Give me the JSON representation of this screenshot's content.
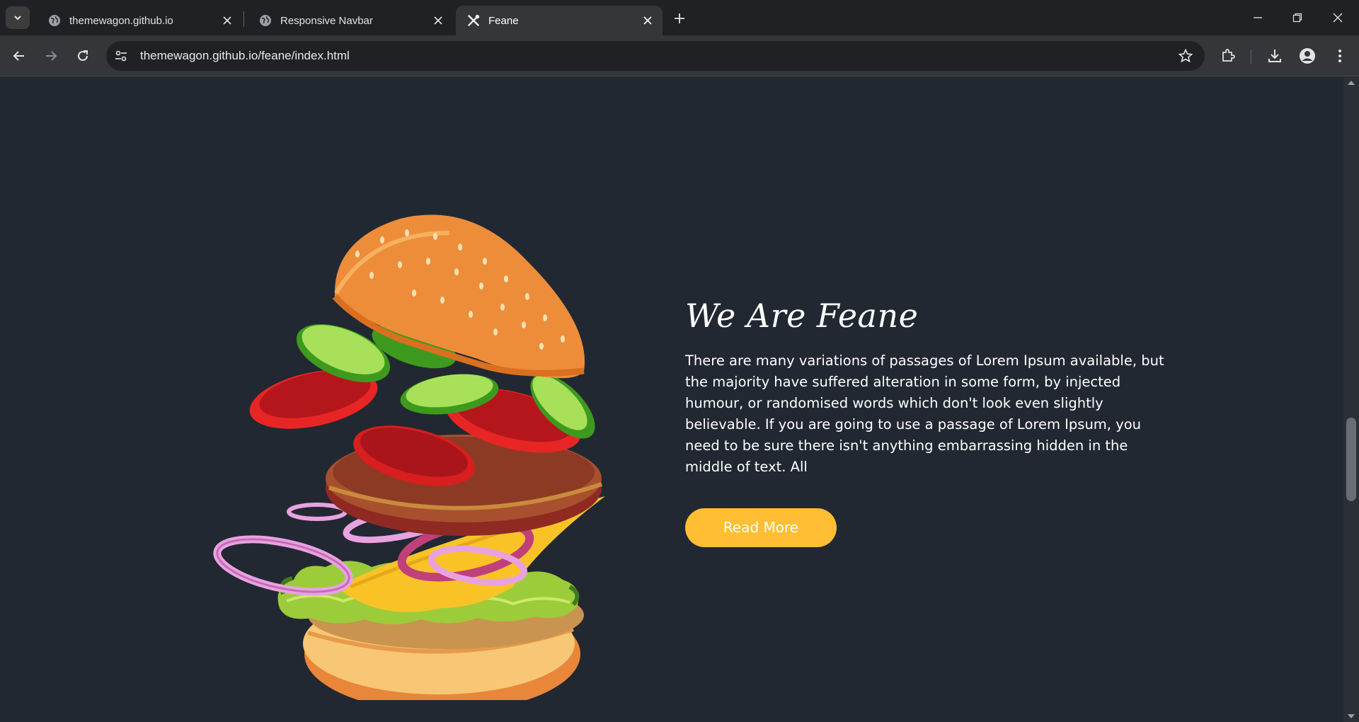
{
  "browser": {
    "tabs": [
      {
        "title": "themewagon.github.io",
        "favicon": "globe-icon",
        "active": false
      },
      {
        "title": "Responsive Navbar",
        "favicon": "globe-icon",
        "active": false
      },
      {
        "title": "Feane",
        "favicon": "utensils-icon",
        "active": true
      }
    ],
    "url": "themewagon.github.io/feane/index.html"
  },
  "about": {
    "heading": "We Are Feane",
    "body": "There are many variations of passages of Lorem Ipsum available, but the majority have suffered alteration in some form, by injected humour, or randomised words which don't look even slightly believable. If you are going to use a passage of Lorem Ipsum, you need to be sure there isn't anything embarrassing hidden in the middle of text. All",
    "button_label": "Read More"
  },
  "colors": {
    "page_background": "#222831",
    "accent": "#ffbe33",
    "text": "#ffffff"
  }
}
